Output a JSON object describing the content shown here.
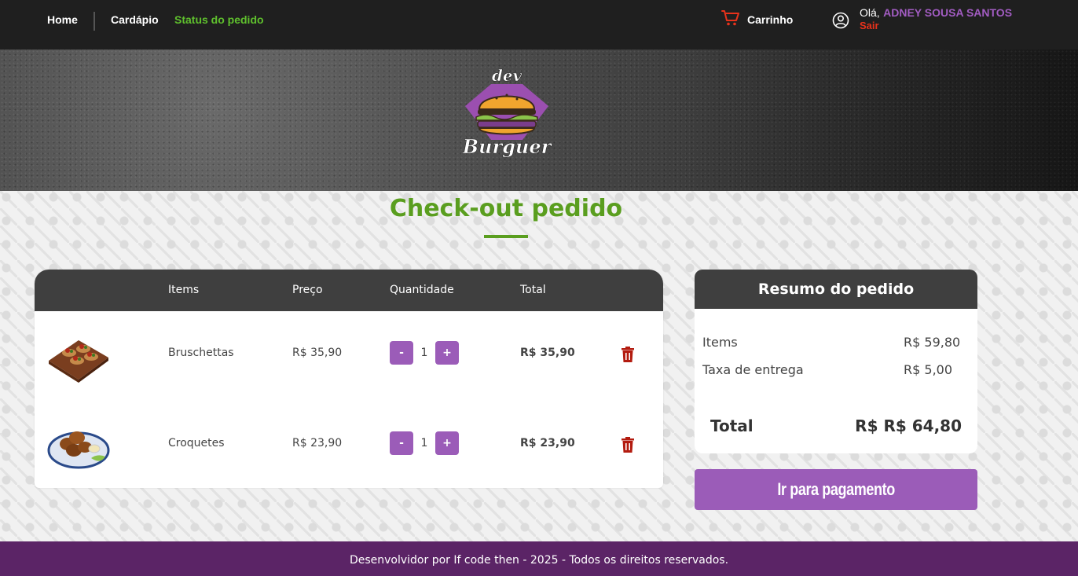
{
  "nav": {
    "home": "Home",
    "menu": "Cardápio",
    "status": "Status do pedido",
    "cart": "Carrinho",
    "hello": "Olá,",
    "username": "ADNEY SOUSA SANTOS",
    "logout": "Sair"
  },
  "logo": {
    "top_text": "dev",
    "bottom_text": "Burguer"
  },
  "page": {
    "title": "Check-out pedido"
  },
  "cart": {
    "headers": {
      "items": "Items",
      "price": "Preço",
      "quantity": "Quantidade",
      "total": "Total"
    },
    "rows": [
      {
        "name": "Bruschettas",
        "price": "R$ 35,90",
        "qty": "1",
        "total": "R$ 35,90",
        "minus": "-",
        "plus": "+"
      },
      {
        "name": "Croquetes",
        "price": "R$ 23,90",
        "qty": "1",
        "total": "R$ 23,90",
        "minus": "-",
        "plus": "+"
      }
    ]
  },
  "summary": {
    "title": "Resumo do pedido",
    "items_label": "Items",
    "items_value": "R$ 59,80",
    "delivery_label": "Taxa de entrega",
    "delivery_value": "R$ 5,00",
    "total_label": "Total",
    "total_value": "R$ R$ 64,80"
  },
  "actions": {
    "pay": "Ir para pagamento"
  },
  "footer": {
    "text": "Desenvolvidor por If code then - 2025 - Todos os direitos reservados."
  },
  "colors": {
    "accent": "#9b5cb8",
    "green": "#5a9e1f",
    "footer": "#5b2466",
    "danger": "#e8321b"
  }
}
